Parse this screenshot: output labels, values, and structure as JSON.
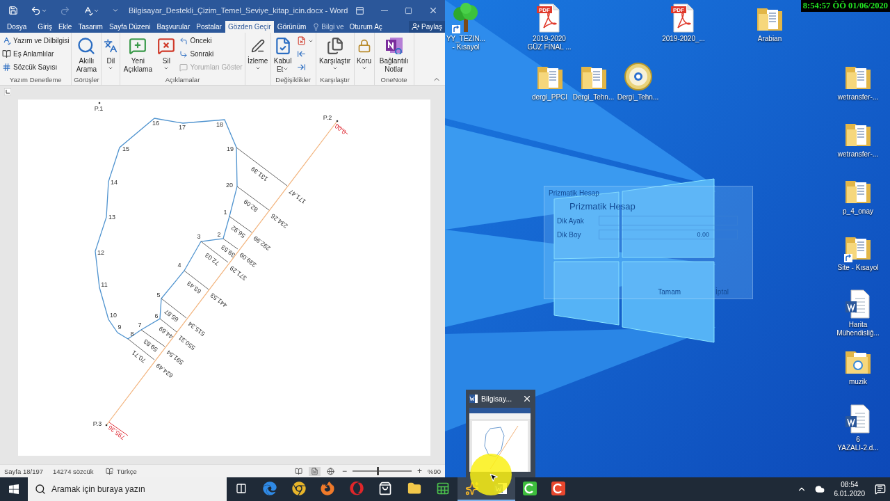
{
  "word_window": {
    "quick_access": {
      "redo": {
        "disabled": true
      }
    },
    "title": "Bilgisayar_Destekli_Çizim_Temel_Seviye_kitap_icin.docx - Word",
    "tabs": [
      {
        "label": "Dosya",
        "selected": false
      },
      {
        "label": "Giriş",
        "selected": false
      },
      {
        "label": "Ekle",
        "selected": false
      },
      {
        "label": "Tasarım",
        "selected": false
      },
      {
        "label": "Sayfa Düzeni",
        "selected": false
      },
      {
        "label": "Başvurular",
        "selected": false
      },
      {
        "label": "Postalar",
        "selected": false
      },
      {
        "label": "Gözden Geçir",
        "selected": true
      },
      {
        "label": "Görünüm",
        "selected": false
      }
    ],
    "tell_me": "Bilgi ve",
    "sign_in": "Oturum Aç",
    "share": "Paylaş",
    "ribbon": {
      "proofing": {
        "spelling": "Yazım ve Dilbilgisi",
        "thesaurus": "Eş Anlamlılar",
        "word_count": "Sözcük Sayısı",
        "group_label": "Yazım Denetleme"
      },
      "insights": {
        "smart_lookup": "Akıllı Arama",
        "group_label": "Görüşler"
      },
      "language": {
        "language": "Dil"
      },
      "comments": {
        "new_comment": "Yeni Açıklama",
        "delete": "Sil",
        "previous": "Önceki",
        "next": "Sonraki",
        "show_comments": {
          "label": "Yorumları Göster",
          "disabled": true
        },
        "group_label": "Açıklamalar"
      },
      "tracking": {
        "tracking": "İzleme"
      },
      "changes": {
        "accept": "Kabul Et",
        "group_label": "Değişiklikler"
      },
      "compare": {
        "compare": "Karşılaştır",
        "group_label": "Karşılaştır"
      },
      "protect": {
        "protect": "Koru"
      },
      "onenote": {
        "linked_notes": "Bağlantılı Notlar",
        "group_label": "OneNote"
      }
    },
    "document": {
      "drawing": {
        "stations": [
          "P.1",
          "P.2",
          "P.3"
        ],
        "vertices": [
          "16",
          "18",
          "17",
          "19",
          "15",
          "14",
          "20",
          "1",
          "13",
          "2",
          "3",
          "12",
          "4",
          "11",
          "5",
          "10",
          "6",
          "7",
          "9",
          "8"
        ],
        "offsets": [
          "131.39",
          "82.09",
          "56.92",
          "39.53",
          "72.03",
          "63.43",
          "65.87",
          "44.69",
          "59.83",
          "70.71"
        ],
        "chainages": [
          "171.47",
          "234.26",
          "292.99",
          "339.09",
          "371.29",
          "441.53",
          "515.34",
          "550.31",
          "591.54",
          "624.49"
        ],
        "start_chainage": "0.00",
        "end_chainage": "795.36"
      }
    },
    "status_bar": {
      "page": "Sayfa 18/197",
      "words": "14274 sözcük",
      "language": "Türkçe",
      "zoom": {
        "minus": "−",
        "plus": "+",
        "level": 0.42,
        "reading": "%90"
      }
    }
  },
  "desktop": {
    "icons": [
      {
        "kind": "tree",
        "shortcut": true,
        "label": "YY_TEZIN...\n- Kısayol"
      },
      {
        "kind": "pdf",
        "shortcut": false,
        "badge": "PDF",
        "label": "2019-2020\nGÜZ FİNAL ..."
      },
      {
        "kind": "pdf",
        "shortcut": false,
        "badge": "PDF",
        "label": "2019-2020_..."
      },
      {
        "kind": "folder",
        "shortcut": false,
        "label": "Arabian"
      },
      {
        "kind": "folder",
        "shortcut": false,
        "label": "dergi_PPCI"
      },
      {
        "kind": "folder",
        "shortcut": false,
        "label": "Dergi_Tehn..."
      },
      {
        "kind": "disc",
        "shortcut": false,
        "label": "Dergi_Tehn..."
      },
      {
        "kind": "folder",
        "shortcut": false,
        "label": "wetransfer-..."
      },
      {
        "kind": "folder",
        "shortcut": false,
        "label": "wetransfer-..."
      },
      {
        "kind": "folder",
        "shortcut": false,
        "label": "p_4_onay"
      },
      {
        "kind": "folder",
        "shortcut": true,
        "label": "Site - Kısayol"
      },
      {
        "kind": "word",
        "shortcut": false,
        "label": "Harita\nMühendisliğ..."
      },
      {
        "kind": "media-folder",
        "shortcut": false,
        "label": "muzik"
      },
      {
        "kind": "word",
        "shortcut": false,
        "label": "6\nYAZALI-2.d..."
      }
    ],
    "ghost_dialog": {
      "title": "Prizmatik Hesap",
      "heading": "Prizmatik Hesap",
      "fields": [
        {
          "label": "Dik Ayak"
        },
        {
          "label": "Dik Boy",
          "value": "0.00"
        }
      ],
      "buttons": [
        "Tamam",
        "İptal"
      ]
    },
    "taskbar_preview": {
      "title": "Bilgisay..."
    }
  },
  "recording_clock": "8:54:57 ÖÖ 01/06/2020",
  "taskbar": {
    "search_placeholder": "Aramak için buraya yazın",
    "apps": [
      {
        "kind": "task-view",
        "active": false
      },
      {
        "kind": "edge",
        "active": false
      },
      {
        "kind": "chrome",
        "active": false
      },
      {
        "kind": "firefox",
        "active": false
      },
      {
        "kind": "opera",
        "active": false
      },
      {
        "kind": "store",
        "active": false
      },
      {
        "kind": "explorer",
        "active": false
      },
      {
        "kind": "sheet",
        "active": false
      },
      {
        "kind": "star",
        "active": true
      },
      {
        "kind": "word",
        "active": true
      },
      {
        "kind": "recorder-green",
        "active": false
      },
      {
        "kind": "recorder-red",
        "active": false
      }
    ],
    "time": "08:54",
    "date": "6.01.2020"
  }
}
